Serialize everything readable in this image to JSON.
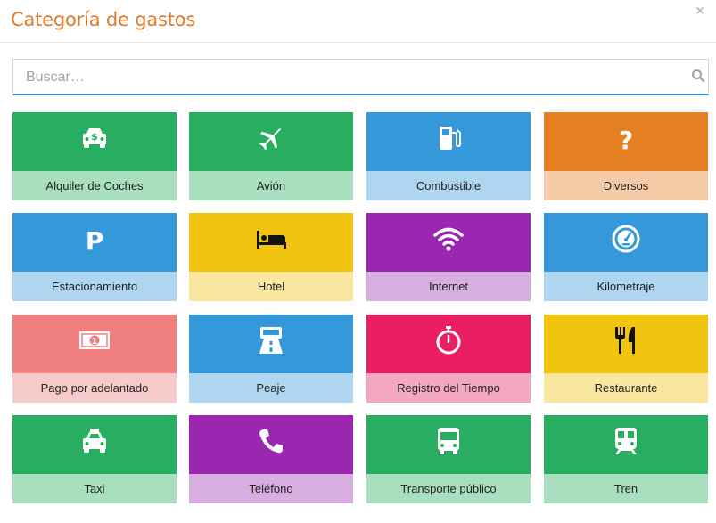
{
  "dialog": {
    "title": "Categoría de gastos",
    "close_label": "×"
  },
  "search": {
    "placeholder": "Buscar…",
    "value": ""
  },
  "categories": [
    {
      "label": "Alquiler de Coches",
      "icon": "car-rental-icon",
      "color": "#27ae60",
      "tint": "#a9dfbf"
    },
    {
      "label": "Avión",
      "icon": "plane-icon",
      "color": "#27ae60",
      "tint": "#a9dfbf"
    },
    {
      "label": "Combustible",
      "icon": "fuel-pump-icon",
      "color": "#3498db",
      "tint": "#aed6f1"
    },
    {
      "label": "Diversos",
      "icon": "question-icon",
      "color": "#e67e22",
      "tint": "#f5cba7"
    },
    {
      "label": "Estacionamiento",
      "icon": "parking-icon",
      "color": "#3498db",
      "tint": "#aed6f1"
    },
    {
      "label": "Hotel",
      "icon": "bed-icon",
      "color": "#f1c40f",
      "tint": "#f9e79f"
    },
    {
      "label": "Internet",
      "icon": "wifi-icon",
      "color": "#9b27b0",
      "tint": "#d7aee0"
    },
    {
      "label": "Kilometraje",
      "icon": "speedometer-icon",
      "color": "#3498db",
      "tint": "#aed6f1"
    },
    {
      "label": "Pago por adelantado",
      "icon": "banknote-icon",
      "color": "#f08080",
      "tint": "#f8cbcb"
    },
    {
      "label": "Peaje",
      "icon": "toll-road-icon",
      "color": "#3498db",
      "tint": "#aed6f1"
    },
    {
      "label": "Registro del Tiempo",
      "icon": "stopwatch-icon",
      "color": "#e91e63",
      "tint": "#f4a7c1"
    },
    {
      "label": "Restaurante",
      "icon": "cutlery-icon",
      "color": "#f1c40f",
      "tint": "#f9e79f"
    },
    {
      "label": "Taxi",
      "icon": "taxi-icon",
      "color": "#27ae60",
      "tint": "#a9dfbf"
    },
    {
      "label": "Teléfono",
      "icon": "phone-icon",
      "color": "#9b27b0",
      "tint": "#d7aee0"
    },
    {
      "label": "Transporte público",
      "icon": "bus-icon",
      "color": "#27ae60",
      "tint": "#a9dfbf"
    },
    {
      "label": "Tren",
      "icon": "train-icon",
      "color": "#27ae60",
      "tint": "#a9dfbf"
    }
  ]
}
